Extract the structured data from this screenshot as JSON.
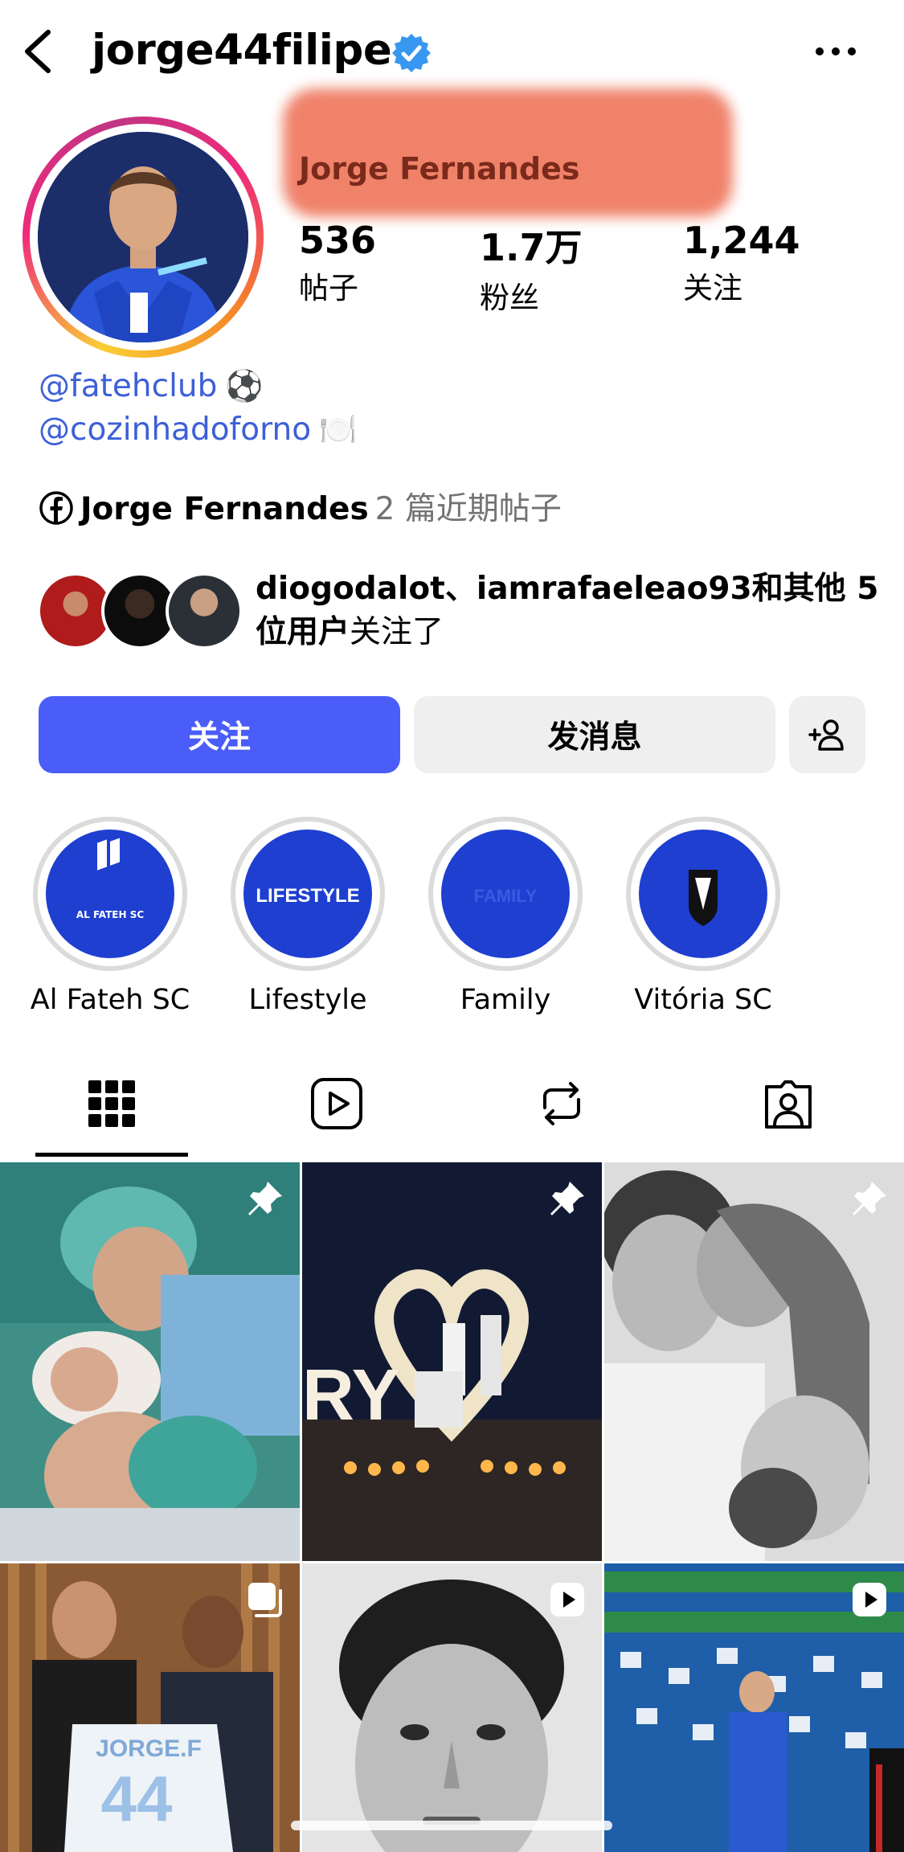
{
  "header": {
    "username": "jorge44filipe",
    "back_icon": "chevron-left-icon",
    "verified_icon": "verified-badge-icon",
    "more_icon": "ellipsis-icon"
  },
  "profile": {
    "display_name": "Jorge Fernandes",
    "stats": [
      {
        "value": "536",
        "label": "帖子"
      },
      {
        "value": "1.7万",
        "label": "粉丝"
      },
      {
        "value": "1,244",
        "label": "关注"
      }
    ],
    "bio": [
      {
        "text": "@fatehclub",
        "emoji": "⚽"
      },
      {
        "text": "@cozinhadoforno",
        "emoji": "🍽️"
      }
    ],
    "facebook": {
      "name": "Jorge Fernandes",
      "suffix": "2 篇近期帖子"
    },
    "mutual": {
      "names": "diogodalot、iamrafaeleao93",
      "and_others": "和其他 5",
      "line2_bold": "位用户",
      "line2_rest": "关注了"
    }
  },
  "actions": {
    "follow_label": "关注",
    "message_label": "发消息",
    "add_icon": "add-person-icon"
  },
  "highlights": [
    {
      "label": "Al Fateh SC",
      "art": "AL FATEH SC"
    },
    {
      "label": "Lifestyle",
      "art": "LIFESTYLE"
    },
    {
      "label": "Family",
      "art": "FAMILY"
    },
    {
      "label": "Vitória SC",
      "art": ""
    }
  ],
  "tabs": [
    {
      "icon": "grid-icon",
      "active": true
    },
    {
      "icon": "reels-icon",
      "active": false
    },
    {
      "icon": "reposts-icon",
      "active": false
    },
    {
      "icon": "tagged-icon",
      "active": false
    }
  ],
  "posts": [
    {
      "badge": "pin-icon"
    },
    {
      "badge": "pin-icon"
    },
    {
      "badge": "pin-icon"
    },
    {
      "badge": "carousel-icon",
      "shirt_text": "JORGE.F"
    },
    {
      "badge": "reel-icon"
    },
    {
      "badge": "reel-icon"
    }
  ]
}
